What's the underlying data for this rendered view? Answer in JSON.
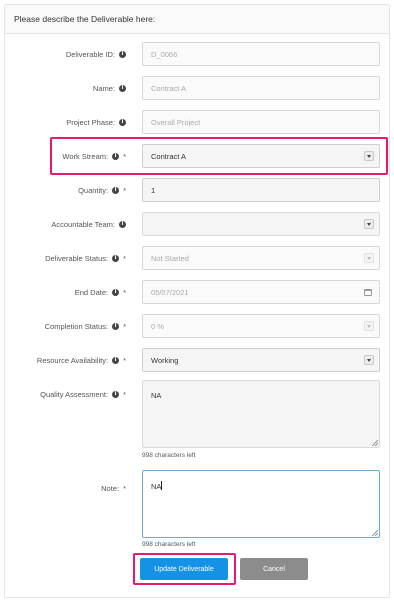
{
  "header": {
    "title": "Please describe the Deliverable here:"
  },
  "fields": {
    "deliverable_id": {
      "label": "Deliverable ID:",
      "value": "D_0066"
    },
    "name": {
      "label": "Name:",
      "value": "Contract A"
    },
    "project_phase": {
      "label": "Project Phase:",
      "value": "Overall Project"
    },
    "work_stream": {
      "label": "Work Stream:",
      "value": "Contract A",
      "required": "*"
    },
    "quantity": {
      "label": "Quantity:",
      "value": "1",
      "required": "*"
    },
    "accountable_team": {
      "label": "Accountable Team:",
      "value": ""
    },
    "deliverable_status": {
      "label": "Deliverable Status:",
      "value": "Not Started",
      "required": "*"
    },
    "end_date": {
      "label": "End Date:",
      "value": "05/07/2021",
      "required": "*"
    },
    "completion_status": {
      "label": "Completion Status:",
      "value": "0 %",
      "required": "*"
    },
    "resource_availability": {
      "label": "Resource Availability:",
      "value": "Working",
      "required": "*"
    },
    "quality_assessment": {
      "label": "Quality Assessment:",
      "value": "NA",
      "required": "*",
      "helper": "998 characters left"
    },
    "note": {
      "label": "Note:",
      "value": "NA",
      "required": "*",
      "helper": "998 characters left"
    }
  },
  "info_icon_glyph": "i",
  "buttons": {
    "update": "Update Deliverable",
    "cancel": "Cancel"
  },
  "colors": {
    "highlight": "#e8196f",
    "primary": "#1592e6",
    "cancel": "#8c8c8c"
  }
}
